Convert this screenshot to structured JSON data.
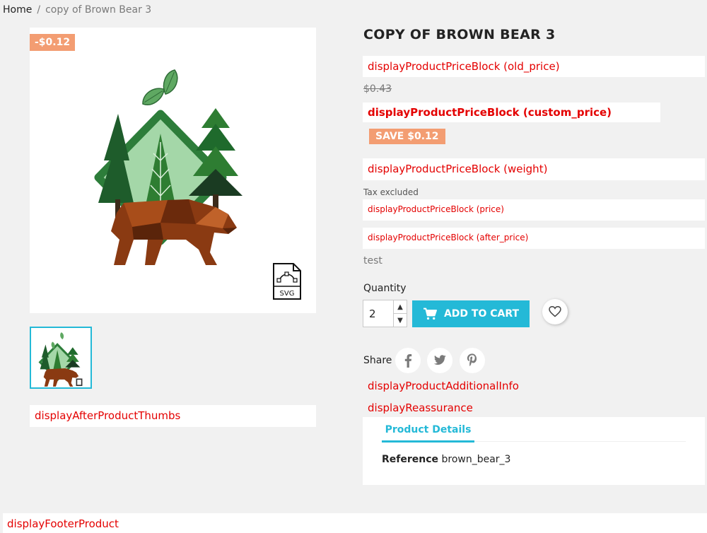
{
  "breadcrumb": {
    "home": "Home",
    "separator": "/",
    "current": "copy of Brown Bear 3"
  },
  "product": {
    "title": "COPY OF BROWN BEAR 3",
    "discount_flag": "-$0.12",
    "old_price": "$0.43",
    "save_badge": "SAVE $0.12",
    "tax_label": "Tax excluded",
    "short_description": "test",
    "svg_badge_text": "SVG"
  },
  "hooks": {
    "old_price": "displayProductPriceBlock (old_price)",
    "custom_price": "displayProductPriceBlock (custom_price)",
    "weight": "displayProductPriceBlock (weight)",
    "price": "displayProductPriceBlock (price)",
    "after_price": "displayProductPriceBlock (after_price)",
    "after_thumbs": "displayAfterProductThumbs",
    "additional_info": "displayProductAdditionalInfo",
    "reassurance": "displayReassurance",
    "footer_product": "displayFooterProduct"
  },
  "purchase": {
    "quantity_label": "Quantity",
    "quantity_value": "2",
    "add_to_cart": "ADD TO CART"
  },
  "share": {
    "label": "Share",
    "networks": [
      "facebook-icon",
      "twitter-icon",
      "pinterest-icon"
    ]
  },
  "tabs": {
    "product_details": "Product Details"
  },
  "details": {
    "reference_label": "Reference",
    "reference_value": "brown_bear_3"
  },
  "colors": {
    "accent": "#24b9d7",
    "discount": "#f39d72",
    "hook_text": "#e40000"
  }
}
